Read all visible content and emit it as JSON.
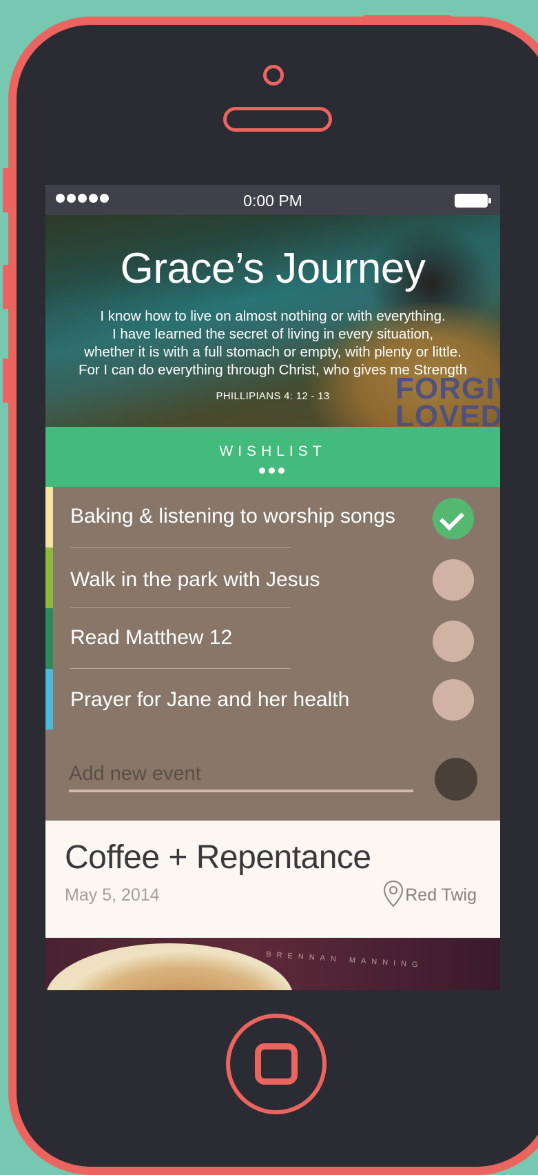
{
  "status_bar": {
    "signal_dots": 5,
    "time": "0:00 PM"
  },
  "hero": {
    "title": "Grace’s Journey",
    "verse_lines": [
      "I know how to live on almost nothing or with everything.",
      "I have learned the secret of living in every situation,",
      "whether it is with a full stomach or empty, with plenty or little.",
      "For I can do everything through Christ, who gives me Strength"
    ],
    "verse_reference": "PHILLIPIANS 4: 12 - 13",
    "shirt_text": [
      "FORGIVE",
      "LOVED"
    ]
  },
  "wishlist": {
    "label": "WISHLIST",
    "items": [
      {
        "label": "Baking & listening to worship songs",
        "done": true,
        "color": "#f5e3a0"
      },
      {
        "label": "Walk in the park with Jesus",
        "done": false,
        "color": "#8cba3f"
      },
      {
        "label": "Read Matthew 12",
        "done": false,
        "color": "#2d8a5a"
      },
      {
        "label": "Prayer for Jane and her health",
        "done": false,
        "color": "#4db8dc"
      }
    ],
    "add_placeholder": "Add new event"
  },
  "event": {
    "title": "Coffee + Repentance",
    "date": "May 5, 2014",
    "location": "Red Twig",
    "photo_text": "BRENNAN MANNING"
  },
  "colors": {
    "phone_frame": "#ec6460",
    "background": "#77c8b0",
    "accent_green": "#42bb7d",
    "list_bg": "#887769"
  }
}
